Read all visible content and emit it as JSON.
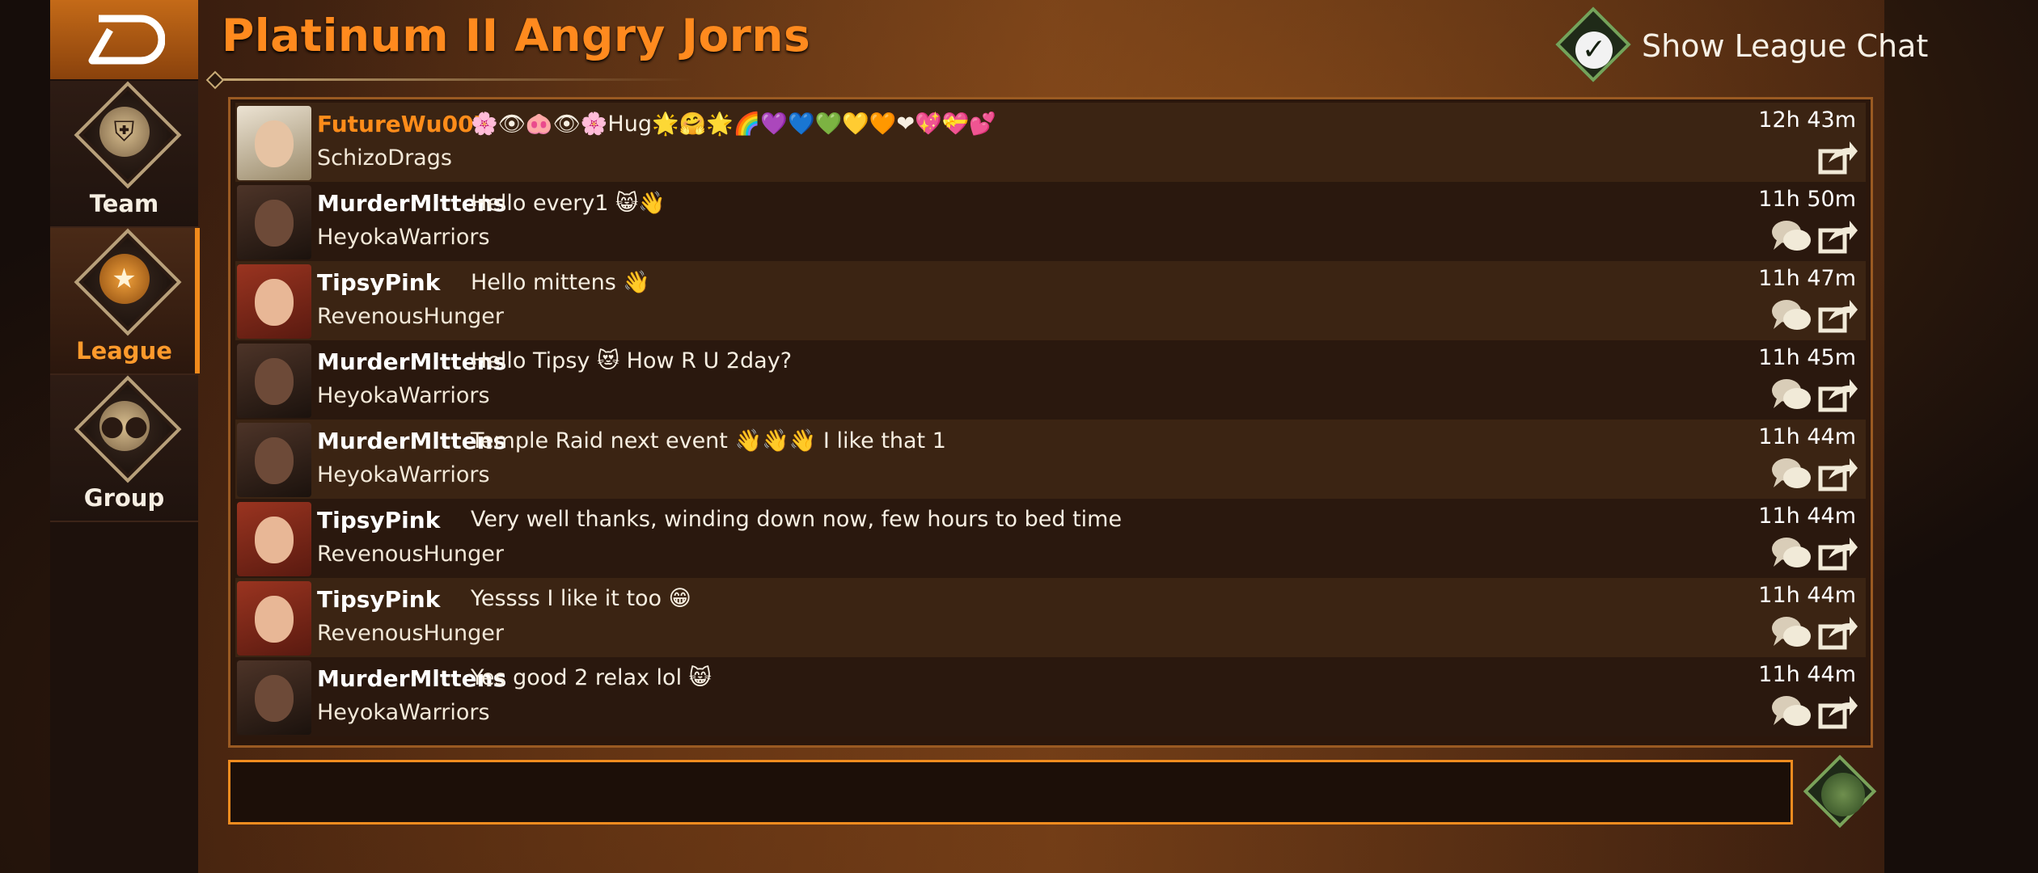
{
  "header": {
    "title": "Platinum II Angry Jorns",
    "toggle_label": "Show League Chat",
    "toggle_checked": true
  },
  "sidebar": {
    "items": [
      {
        "label": "Team",
        "icon": "shield-people-icon",
        "active": false
      },
      {
        "label": "League",
        "icon": "trophy-icon",
        "active": true
      },
      {
        "label": "Group",
        "icon": "group-icon",
        "active": false
      }
    ]
  },
  "chat": {
    "messages": [
      {
        "user": "FutureWu007",
        "team": "SchizoDrags",
        "text": "🌸👁🐽👁🌸Hug🌟🤗🌟🌈💜💙💚💛🧡❤💖💝💕",
        "time": "12h 43m",
        "highlight": true
      },
      {
        "user": "MurderMlttens",
        "team": "HeyokaWarriors",
        "text": "Hello every1 😸👋",
        "time": "11h 50m"
      },
      {
        "user": "TipsyPink",
        "team": "RevenousHunger",
        "text": "Hello mittens 👋",
        "time": "11h 47m"
      },
      {
        "user": "MurderMlttens",
        "team": "HeyokaWarriors",
        "text": "Hello Tipsy 😻 How R U 2day?",
        "time": "11h 45m"
      },
      {
        "user": "MurderMlttens",
        "team": "HeyokaWarriors",
        "text": "Temple Raid next event 👋👋👋 I like that 1",
        "time": "11h 44m"
      },
      {
        "user": "TipsyPink",
        "team": "RevenousHunger",
        "text": "Very well thanks, winding down now, few hours to bed time",
        "time": "11h 44m"
      },
      {
        "user": "TipsyPink",
        "team": "RevenousHunger",
        "text": "Yessss I like it too 😁",
        "time": "11h 44m"
      },
      {
        "user": "MurderMlttens",
        "team": "HeyokaWarriors",
        "text": "Yes good 2 relax lol 😸",
        "time": "11h 44m"
      }
    ]
  },
  "input": {
    "placeholder": "",
    "value": ""
  },
  "colors": {
    "accent": "#ff8a1e",
    "toggle_green": "#74a35a"
  }
}
